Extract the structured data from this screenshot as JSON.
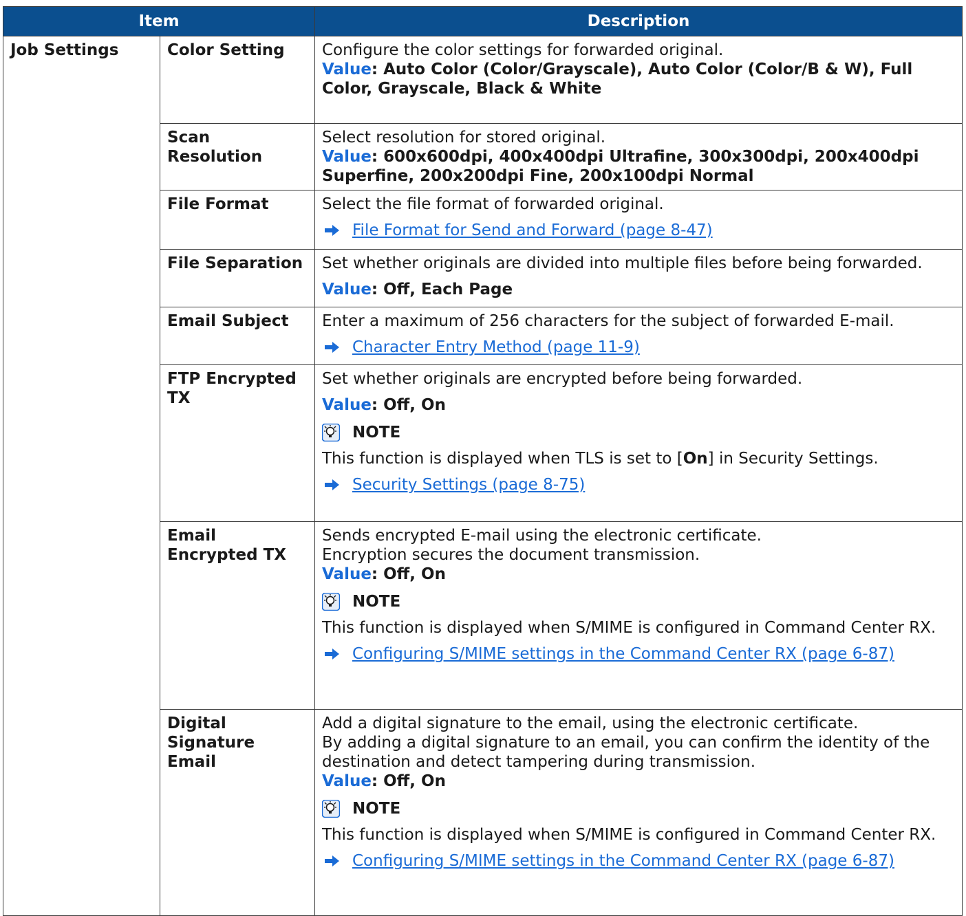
{
  "header": {
    "item": "Item",
    "description": "Description"
  },
  "group_label": "Job Settings",
  "value_label": "Value",
  "note_label": "NOTE",
  "rows": [
    {
      "name": "Color Setting",
      "desc": "Configure the color settings for forwarded original.",
      "value": ": Auto Color (Color/Grayscale), Auto Color (Color/B & W), Full Color, Grayscale, Black & White"
    },
    {
      "name": "Scan Resolution",
      "desc": "Select resolution for stored original.",
      "value": ": 600x600dpi, 400x400dpi Ultrafine, 300x300dpi, 200x400dpi Superfine, 200x200dpi Fine, 200x100dpi Normal"
    },
    {
      "name": "File Format",
      "desc": "Select the file format of forwarded original.",
      "link": "File Format for Send and Forward (page 8-47)"
    },
    {
      "name": "File Separation",
      "desc": "Set whether originals are divided into multiple files before being forwarded.",
      "value": ": Off, Each Page"
    },
    {
      "name": "Email Subject",
      "desc": "Enter a maximum of 256 characters for the subject of forwarded E-mail.",
      "link": "Character Entry Method (page 11-9)"
    },
    {
      "name": "FTP Encrypted TX",
      "desc": "Set whether originals are encrypted before being forwarded.",
      "value": ": Off, On",
      "note_pre": "This function is displayed when TLS is set to [",
      "note_bold": "On",
      "note_post": "] in Security Settings.",
      "link": "Security Settings (page 8-75)"
    },
    {
      "name": "Email Encrypted TX",
      "desc": "Sends encrypted E-mail using the electronic certificate.",
      "desc2": "Encryption secures the document transmission.",
      "value": ": Off, On",
      "note": "This function is displayed when S/MIME is configured in Command Center RX.",
      "link": "Configuring S/MIME settings in the Command Center RX (page 6-87)"
    },
    {
      "name": "Digital Signature Email",
      "desc": "Add a digital signature to the email, using the electronic certificate.",
      "desc2": "By adding a digital signature to an email, you can confirm the identity of the destination and detect tampering during transmission.",
      "value": ": Off, On",
      "note": "This function is displayed when S/MIME is configured in Command Center RX.",
      "link": "Configuring S/MIME settings in the Command Center RX (page 6-87)"
    }
  ]
}
